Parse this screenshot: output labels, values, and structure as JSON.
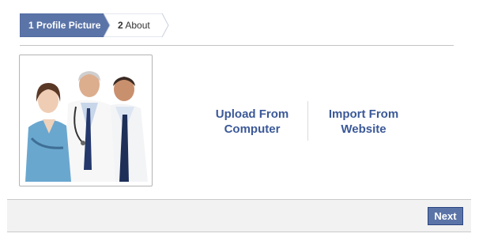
{
  "steps": [
    {
      "number": "1",
      "label": "Profile Picture",
      "active": true
    },
    {
      "number": "2",
      "label": "About",
      "active": false
    }
  ],
  "photo": {
    "icon": "doctors-photo"
  },
  "upload_options": {
    "computer": {
      "line1": "Upload From",
      "line2": "Computer"
    },
    "website": {
      "line1": "Import From",
      "line2": "Website"
    }
  },
  "footer": {
    "next_label": "Next"
  },
  "colors": {
    "brand_blue": "#3b5998",
    "step_active_bg": "#5b74a8",
    "button_border": "#29447e",
    "footer_bg": "#f2f2f2"
  }
}
